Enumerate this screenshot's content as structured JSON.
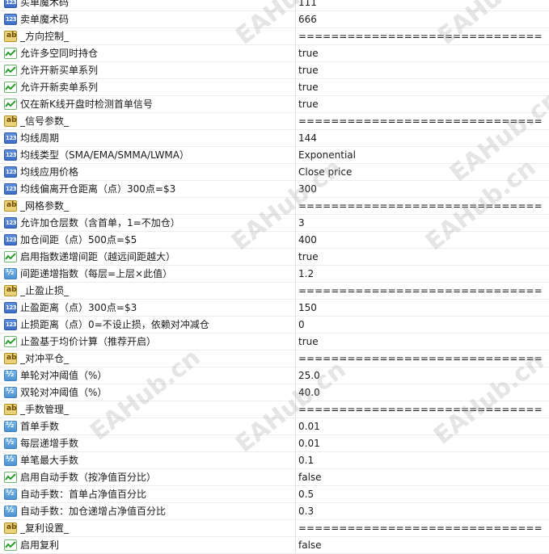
{
  "rows": [
    {
      "icon": "num",
      "name": "买单魔术码",
      "value": "111"
    },
    {
      "icon": "num",
      "name": "卖单魔术码",
      "value": "666"
    },
    {
      "icon": "ab",
      "name": "_方向控制_",
      "value": "=============================="
    },
    {
      "icon": "bool",
      "name": "允许多空同时持仓",
      "value": "true"
    },
    {
      "icon": "bool",
      "name": "允许开新买单系列",
      "value": "true"
    },
    {
      "icon": "bool",
      "name": "允许开新卖单系列",
      "value": "true"
    },
    {
      "icon": "bool",
      "name": "仅在新K线开盘时检测首单信号",
      "value": "true"
    },
    {
      "icon": "ab",
      "name": "_信号参数_",
      "value": "=============================="
    },
    {
      "icon": "num",
      "name": "均线周期",
      "value": "144"
    },
    {
      "icon": "num",
      "name": "均线类型（SMA/EMA/SMMA/LWMA）",
      "value": "Exponential"
    },
    {
      "icon": "num",
      "name": "均线应用价格",
      "value": "Close price"
    },
    {
      "icon": "num",
      "name": "均线偏离开仓距离（点）300点=$3",
      "value": "300"
    },
    {
      "icon": "ab",
      "name": "_网格参数_",
      "value": "=============================="
    },
    {
      "icon": "num",
      "name": "允许加仓层数（含首单，1=不加仓）",
      "value": "3"
    },
    {
      "icon": "num",
      "name": "加仓间距（点）500点=$5",
      "value": "400"
    },
    {
      "icon": "bool",
      "name": "启用指数递增间距（越远间距越大）",
      "value": "true"
    },
    {
      "icon": "dbl",
      "name": "间距递增指数（每层=上层×此值）",
      "value": "1.2"
    },
    {
      "icon": "ab",
      "name": "_止盈止损_",
      "value": "=============================="
    },
    {
      "icon": "num",
      "name": "止盈距离（点）300点=$3",
      "value": "150"
    },
    {
      "icon": "num",
      "name": "止损距离（点）0=不设止损，依赖对冲减仓",
      "value": "0"
    },
    {
      "icon": "bool",
      "name": "止盈基于均价计算（推荐开启）",
      "value": "true"
    },
    {
      "icon": "ab",
      "name": "_对冲平仓_",
      "value": "=============================="
    },
    {
      "icon": "dbl",
      "name": "单轮对冲阈值（%）",
      "value": "25.0"
    },
    {
      "icon": "dbl",
      "name": "双轮对冲阈值（%）",
      "value": "40.0"
    },
    {
      "icon": "ab",
      "name": "_手数管理_",
      "value": "=============================="
    },
    {
      "icon": "dbl",
      "name": "首单手数",
      "value": "0.01"
    },
    {
      "icon": "dbl",
      "name": "每层递增手数",
      "value": "0.01"
    },
    {
      "icon": "dbl",
      "name": "单笔最大手数",
      "value": "0.1"
    },
    {
      "icon": "bool",
      "name": "启用自动手数（按净值百分比）",
      "value": "false"
    },
    {
      "icon": "dbl",
      "name": "自动手数：首单占净值百分比",
      "value": "0.5"
    },
    {
      "icon": "dbl",
      "name": "自动手数：加仓递增占净值百分比",
      "value": "0.3"
    },
    {
      "icon": "ab",
      "name": "_复利设置_",
      "value": "=============================="
    },
    {
      "icon": "bool",
      "name": "启用复利",
      "value": "false"
    }
  ],
  "watermark": "EAHub.cn"
}
